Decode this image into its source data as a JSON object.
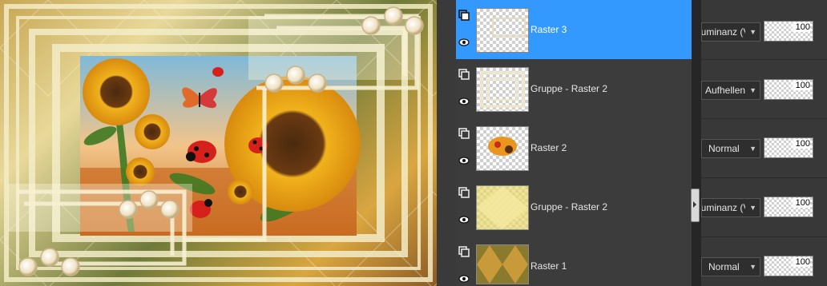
{
  "layers": [
    {
      "name": "Raster 3",
      "blend_mode": "Luminanz (Vorversion)",
      "opacity": "100",
      "selected": true
    },
    {
      "name": "Gruppe - Raster 2",
      "blend_mode": "Aufhellen",
      "opacity": "100",
      "selected": false
    },
    {
      "name": "Raster 2",
      "blend_mode": "Normal",
      "opacity": "100",
      "selected": false
    },
    {
      "name": "Gruppe - Raster 2",
      "blend_mode": "Luminanz (Vorversion)",
      "opacity": "100",
      "selected": false
    },
    {
      "name": "Raster 1",
      "blend_mode": "Normal",
      "opacity": "100",
      "selected": false
    }
  ],
  "colors": {
    "selected": "#3399ff",
    "panel": "#383838",
    "row": "#3c3c3c"
  },
  "icons": {
    "visibility": "eye-icon",
    "layer_type": "raster-layer-icon",
    "dropdown": "chevron-down-icon"
  }
}
